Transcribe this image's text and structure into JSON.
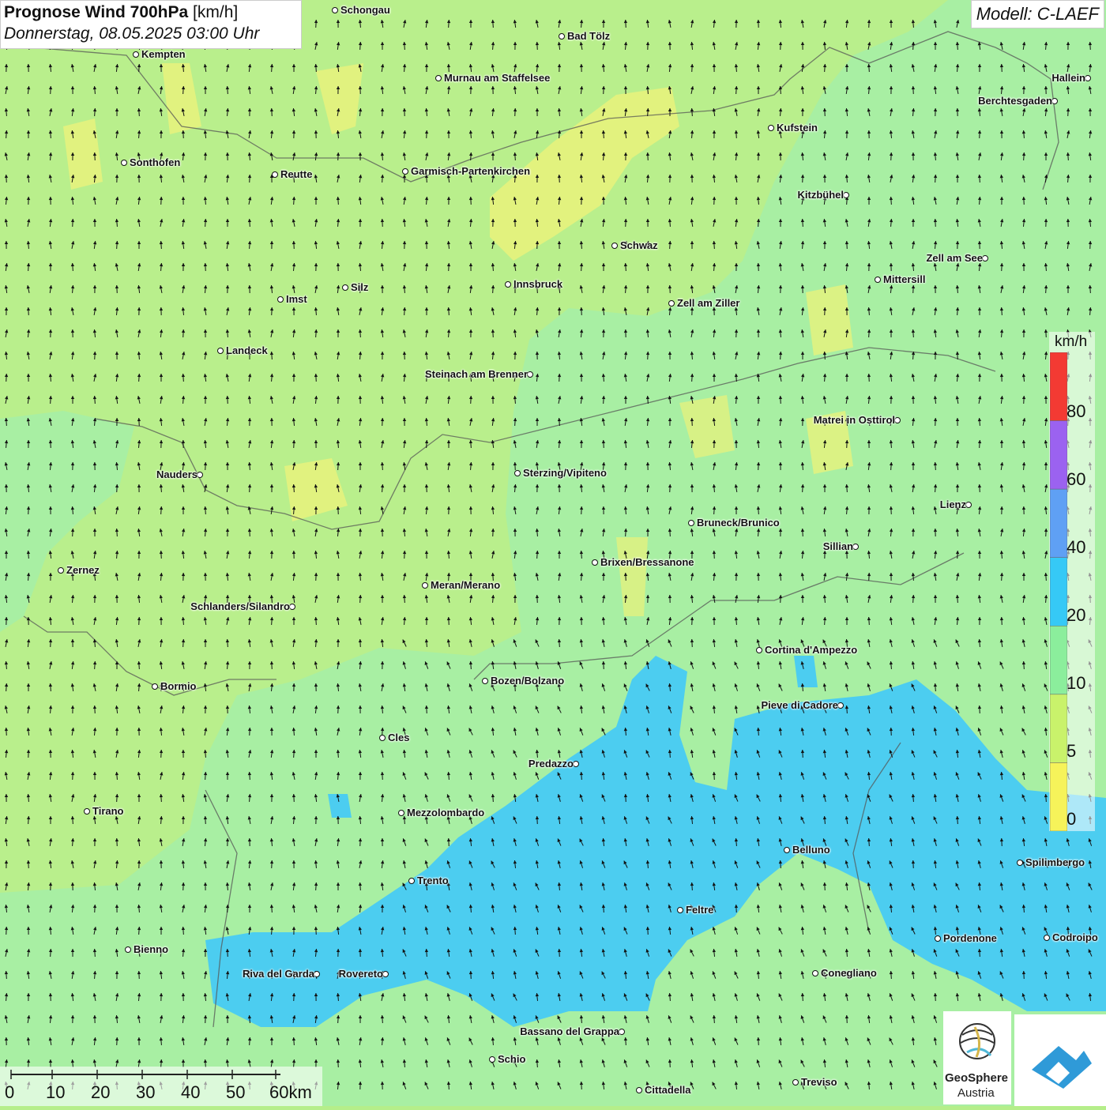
{
  "header": {
    "title_bold": "Prognose Wind 700hPa",
    "title_unit": "[km/h]",
    "datetime": "Donnerstag, 08.05.2025 03:00 Uhr",
    "model": "Modell: C-LAEF"
  },
  "legend": {
    "unit": "km/h",
    "labels": [
      "80",
      "60",
      "40",
      "20",
      "10",
      "5",
      "0"
    ],
    "colors": [
      "#f33a33",
      "#9b62f0",
      "#5fa0f4",
      "#36c9f6",
      "#8bee9c",
      "#c9f26b",
      "#f6f35a"
    ]
  },
  "scale_bar": {
    "labels": [
      "0",
      "10",
      "20",
      "30",
      "40",
      "50",
      "60km"
    ]
  },
  "wind_field": {
    "prevailing_direction": "north",
    "colors": {
      "calm": "#e6f37a",
      "light": "#bdf08a",
      "moderate": "#a7efa2",
      "strong": "#4ccdf0"
    }
  },
  "cities": [
    {
      "name": "Schongau"
    },
    {
      "name": "Bad Tölz"
    },
    {
      "name": "Kempten"
    },
    {
      "name": "Murnau am Staffelsee"
    },
    {
      "name": "Hallein"
    },
    {
      "name": "Berchtesgaden"
    },
    {
      "name": "Kufstein"
    },
    {
      "name": "Sonthofen"
    },
    {
      "name": "Reutte"
    },
    {
      "name": "Garmisch-Partenkirchen"
    },
    {
      "name": "Kitzbühel"
    },
    {
      "name": "Schwaz"
    },
    {
      "name": "Zell am See"
    },
    {
      "name": "Mittersill"
    },
    {
      "name": "Innsbruck"
    },
    {
      "name": "Silz"
    },
    {
      "name": "Imst"
    },
    {
      "name": "Zell am Ziller"
    },
    {
      "name": "Landeck"
    },
    {
      "name": "Steinach am Brenner"
    },
    {
      "name": "Matrei in Osttirol"
    },
    {
      "name": "Nauders"
    },
    {
      "name": "Sterzing/Vipiteno"
    },
    {
      "name": "Lienz"
    },
    {
      "name": "Bruneck/Brunico"
    },
    {
      "name": "Sillian"
    },
    {
      "name": "Brixen/Bressanone"
    },
    {
      "name": "Zernez"
    },
    {
      "name": "Meran/Merano"
    },
    {
      "name": "Schlanders/Silandro"
    },
    {
      "name": "Cortina d'Ampezzo"
    },
    {
      "name": "Bozen/Bolzano"
    },
    {
      "name": "Bormio"
    },
    {
      "name": "Pieve di Cadore"
    },
    {
      "name": "Cles"
    },
    {
      "name": "Predazzo"
    },
    {
      "name": "Tirano"
    },
    {
      "name": "Mezzolombardo"
    },
    {
      "name": "Belluno"
    },
    {
      "name": "Spilimbergo"
    },
    {
      "name": "Trento"
    },
    {
      "name": "Feltre"
    },
    {
      "name": "Pordenone"
    },
    {
      "name": "Codroipo"
    },
    {
      "name": "Bienno"
    },
    {
      "name": "Riva del Garda"
    },
    {
      "name": "Rovereto"
    },
    {
      "name": "Conegliano"
    },
    {
      "name": "Bassano del Grappa"
    },
    {
      "name": "Schio"
    },
    {
      "name": "Treviso"
    },
    {
      "name": "Cittadella"
    }
  ],
  "logos": {
    "geosphere_line1": "GeoSphere",
    "geosphere_line2": "Austria"
  }
}
